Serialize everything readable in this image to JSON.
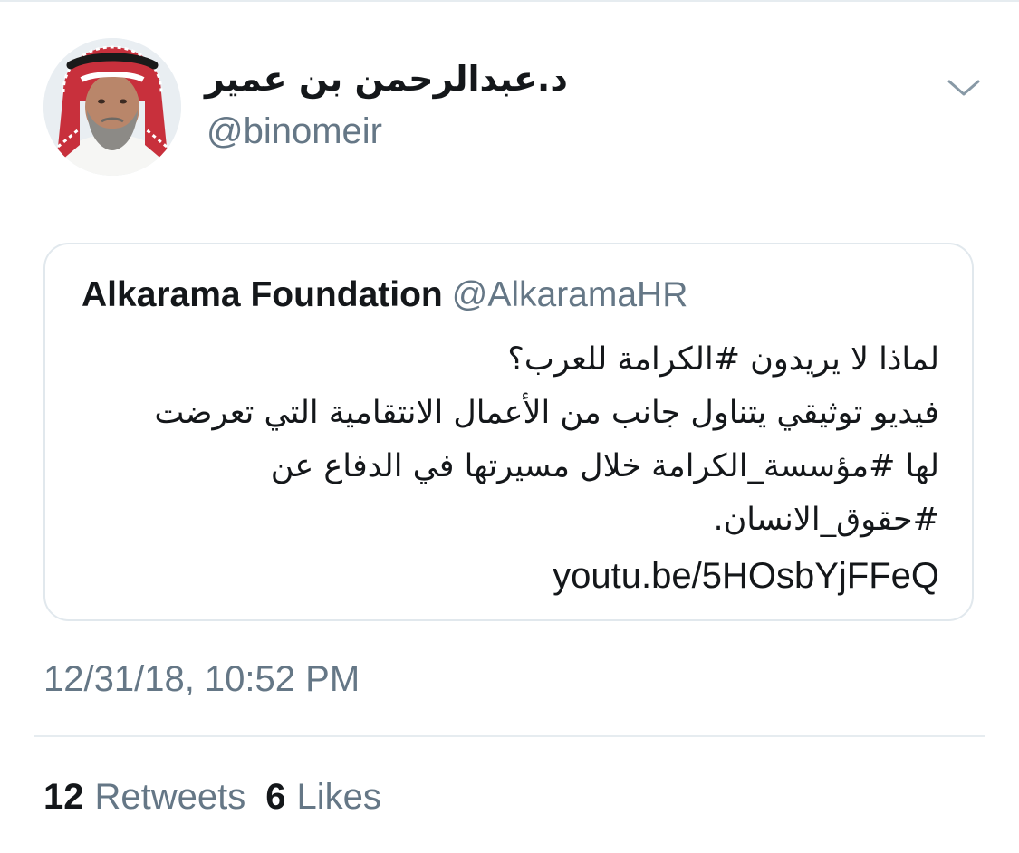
{
  "author": {
    "display_name": "د.عبدالرحمن بن عمير",
    "username": "@binomeir"
  },
  "menu_icon": "chevron-down-icon",
  "quoted_tweet": {
    "name": "Alkarama Foundation",
    "handle": "@AlkaramaHR",
    "lines": [
      "لماذا لا يريدون #الكرامة للعرب؟",
      "فيديو توثيقي يتناول جانب من الأعمال الانتقامية التي تعرضت",
      "لها #مؤسسة_الكرامة خلال مسيرتها في الدفاع عن",
      "#حقوق_الانسان."
    ],
    "link": "youtu.be/5HOsbYjFFeQ"
  },
  "timestamp": "12/31/18, 10:52 PM",
  "stats": {
    "retweets_count": "12",
    "retweets_label": "Retweets",
    "likes_count": "6",
    "likes_label": "Likes"
  },
  "colors": {
    "text_primary": "#14171a",
    "text_secondary": "#657786",
    "border": "#e1e8ed",
    "divider": "#e6ecf0"
  }
}
